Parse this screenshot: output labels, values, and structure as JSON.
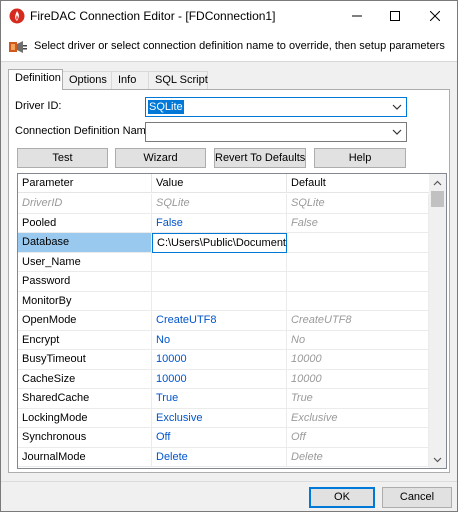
{
  "window": {
    "title": "FireDAC Connection Editor - [FDConnection1]",
    "icon": "firedac-flame-icon"
  },
  "header": {
    "instruction": "Select driver or select connection definition name to override, then setup parameters",
    "icon": "driver-plug-icon"
  },
  "tabs": [
    {
      "label": "Definition",
      "active": true
    },
    {
      "label": "Options",
      "active": false
    },
    {
      "label": "Info",
      "active": false
    },
    {
      "label": "SQL Script",
      "active": false
    }
  ],
  "form": {
    "driver_label": "Driver ID:",
    "driver_value": "SQLite",
    "conndef_label": "Connection Definition Name:",
    "conndef_value": ""
  },
  "actions": {
    "test": "Test",
    "wizard": "Wizard",
    "revert": "Revert To Defaults",
    "help": "Help"
  },
  "grid": {
    "columns": [
      "Parameter",
      "Value",
      "Default"
    ],
    "rows": [
      {
        "param": "DriverID",
        "value": "SQLite",
        "default": "SQLite",
        "readonly": true
      },
      {
        "param": "Pooled",
        "value": "False",
        "default": "False"
      },
      {
        "param": "Database",
        "value": "C:\\Users\\Public\\Documents\\E",
        "default": "",
        "selected": true
      },
      {
        "param": "User_Name",
        "value": "",
        "default": ""
      },
      {
        "param": "Password",
        "value": "",
        "default": ""
      },
      {
        "param": "MonitorBy",
        "value": "",
        "default": ""
      },
      {
        "param": "OpenMode",
        "value": "CreateUTF8",
        "default": "CreateUTF8"
      },
      {
        "param": "Encrypt",
        "value": "No",
        "default": "No"
      },
      {
        "param": "BusyTimeout",
        "value": "10000",
        "default": "10000"
      },
      {
        "param": "CacheSize",
        "value": "10000",
        "default": "10000"
      },
      {
        "param": "SharedCache",
        "value": "True",
        "default": "True"
      },
      {
        "param": "LockingMode",
        "value": "Exclusive",
        "default": "Exclusive"
      },
      {
        "param": "Synchronous",
        "value": "Off",
        "default": "Off"
      },
      {
        "param": "JournalMode",
        "value": "Delete",
        "default": "Delete"
      }
    ]
  },
  "dialog_buttons": {
    "ok": "OK",
    "cancel": "Cancel"
  },
  "colors": {
    "accent": "#0078d7",
    "value_text": "#0055cc",
    "default_text": "#9a9a9a",
    "selected_row": "#99c9ef"
  }
}
